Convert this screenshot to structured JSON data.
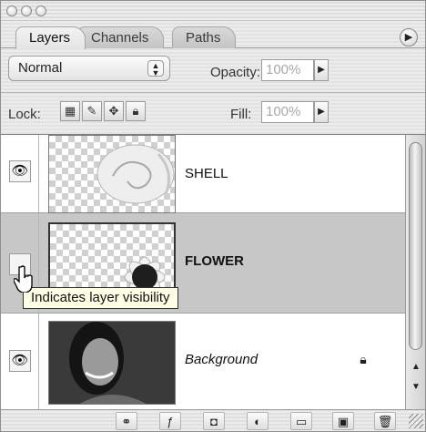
{
  "panel": {
    "tabs": [
      {
        "label": "Layers",
        "active": true
      },
      {
        "label": "Channels",
        "active": false
      },
      {
        "label": "Paths",
        "active": false
      }
    ],
    "menu_icon": "circle-arrow-icon"
  },
  "blend": {
    "mode": "Normal",
    "opacity_label": "Opacity:",
    "opacity_value": "100%"
  },
  "lock": {
    "label": "Lock:",
    "fill_label": "Fill:",
    "fill_value": "100%",
    "buttons": [
      "lock-transparent-pixels-icon",
      "lock-image-pixels-icon",
      "lock-position-icon",
      "lock-all-icon"
    ]
  },
  "layers": [
    {
      "name": "SHELL",
      "visible": true,
      "selected": false,
      "bold": false,
      "italic": false
    },
    {
      "name": "FLOWER",
      "visible": false,
      "selected": true,
      "bold": true,
      "italic": false
    },
    {
      "name": "Background",
      "visible": true,
      "selected": false,
      "bold": false,
      "italic": true,
      "locked": true
    }
  ],
  "tooltip": {
    "text": "Indicates layer visibility"
  },
  "toolbar": {
    "buttons": [
      "link-layers-icon",
      "layer-style-icon",
      "layer-mask-icon",
      "adjustment-layer-icon",
      "new-group-icon",
      "new-layer-icon",
      "trash-icon"
    ]
  },
  "colors": {
    "selected_row": "#c7c7c7",
    "tooltip_bg": "#ffffe6"
  }
}
